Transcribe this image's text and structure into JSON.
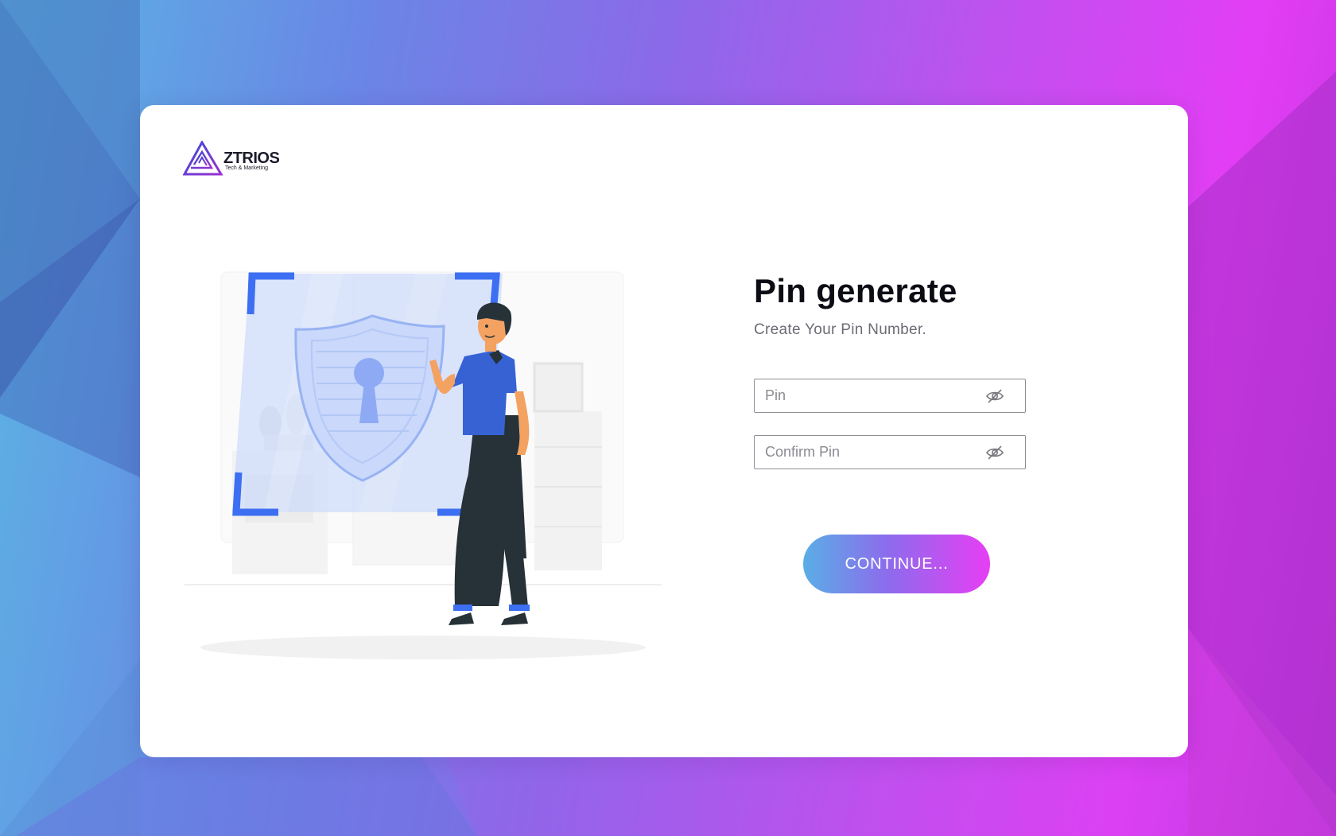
{
  "brand": {
    "name": "ZTRIOS",
    "tagline": "Tech & Marketing"
  },
  "form": {
    "title": "Pin generate",
    "subtitle": "Create Your Pin Number.",
    "pin_placeholder": "Pin",
    "confirm_placeholder": "Confirm Pin",
    "continue_label": "CONTINUE..."
  },
  "icons": {
    "pin_visibility": "eye-slash-icon",
    "confirm_visibility": "eye-slash-icon",
    "illustration": "person-with-security-shield-keyhole"
  },
  "colors": {
    "gradient_start": "#5ab6e2",
    "gradient_mid": "#8a6ae8",
    "gradient_end": "#e33ef5",
    "accent_blue": "#3b6df0",
    "title": "#0c0c14"
  }
}
